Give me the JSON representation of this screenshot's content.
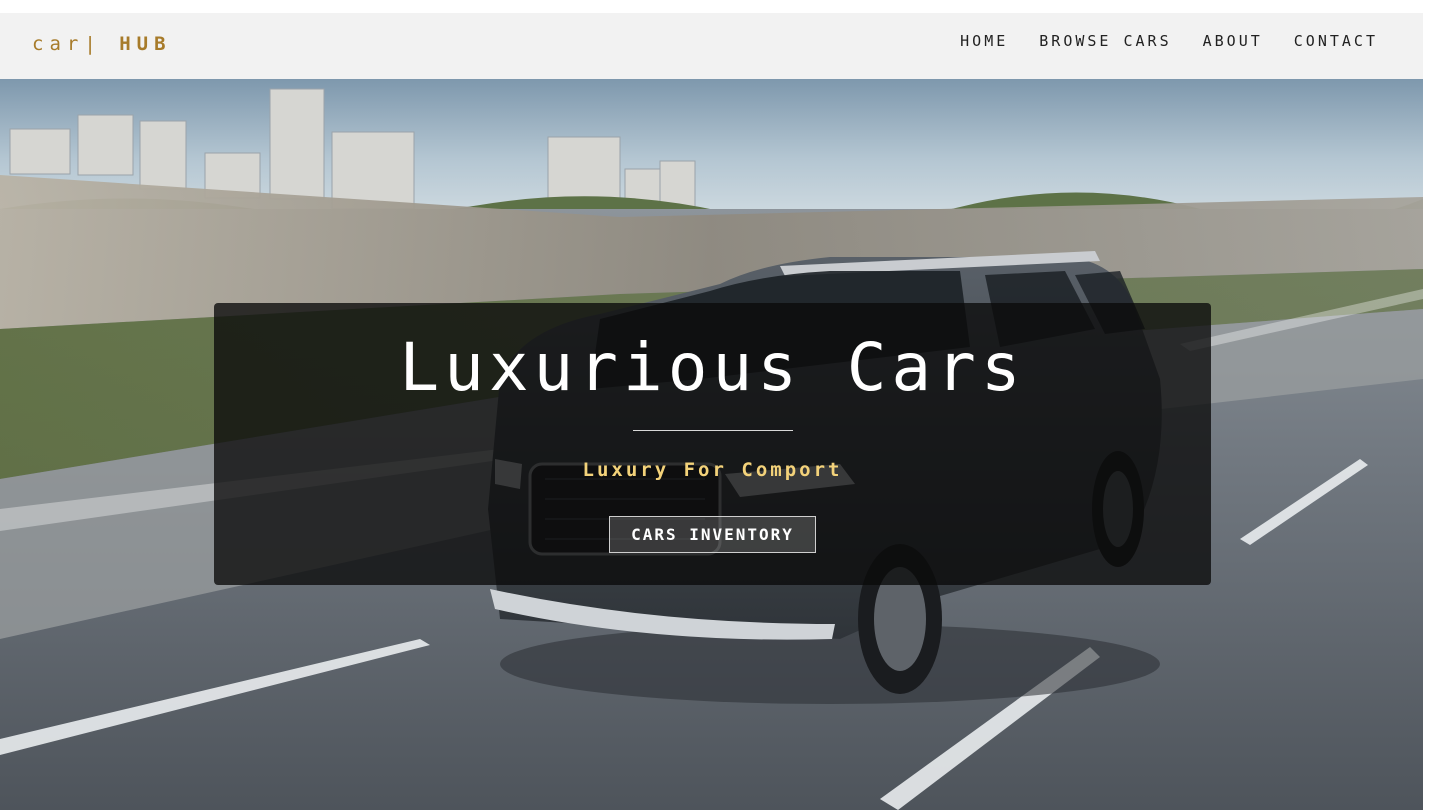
{
  "brand": {
    "logo_light": "car|",
    "logo_bold": "HUB",
    "accent_color": "#a77b2a"
  },
  "nav": {
    "items": [
      {
        "label": "HOME"
      },
      {
        "label": "BROWSE CARS"
      },
      {
        "label": "ABOUT"
      },
      {
        "label": "CONTACT"
      }
    ]
  },
  "hero": {
    "title": "Luxurious Cars",
    "subtitle": "Luxury For Comport",
    "subtitle_color": "#f3d27a",
    "button_label": "CARS INVENTORY",
    "image_icon": "suv-on-highway-photo"
  }
}
